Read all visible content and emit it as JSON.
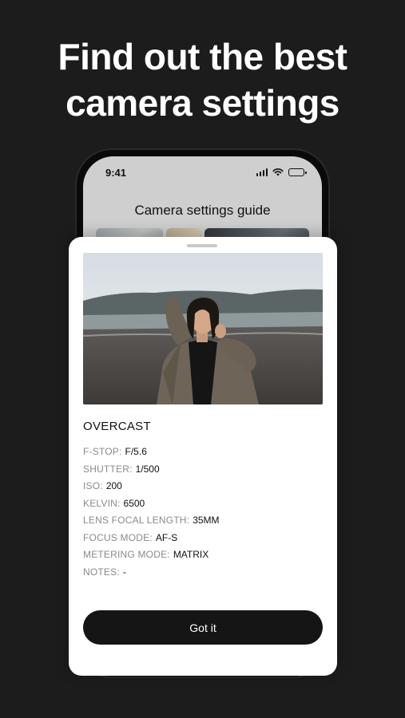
{
  "headline": {
    "line1": "Find out the best",
    "line2": "camera settings"
  },
  "phone": {
    "status_time": "9:41",
    "screen_title": "Camera settings guide"
  },
  "sheet": {
    "photo_icon": "portrait-photo",
    "title": "OVERCAST",
    "rows": [
      {
        "label": "F-STOP:",
        "value": "F/5.6"
      },
      {
        "label": "SHUTTER:",
        "value": "1/500"
      },
      {
        "label": "ISO:",
        "value": "200"
      },
      {
        "label": "KELVIN:",
        "value": "6500"
      },
      {
        "label": "LENS FOCAL LENGTH:",
        "value": "35MM"
      },
      {
        "label": "FOCUS MODE:",
        "value": "AF-S"
      },
      {
        "label": "METERING MODE:",
        "value": "MATRIX"
      },
      {
        "label": "NOTES:",
        "value": "-"
      }
    ],
    "button_label": "Got it"
  },
  "colors": {
    "background": "#1c1c1c",
    "card": "#ffffff",
    "button": "#151515",
    "label_gray": "#8a8a8a"
  }
}
